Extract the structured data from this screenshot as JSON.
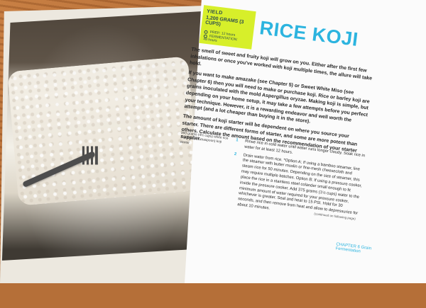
{
  "recipe": {
    "yield_label": "YIELD",
    "yield_value": "1,200 GRAMS (3 CUPS)",
    "prep_label": "PREP: 12 hours",
    "fermentation_label": "FERMENTATION:",
    "fermentation_value": "48 hours",
    "title": "RICE KOJI"
  },
  "content": {
    "intro_1": "The smell of sweet and fruity koji will grow on you. Either after the first few inhalations or once you've worked with koji multiple times, the allure will take hold.",
    "intro_2": "If you want to make amazake (see Chapter 5) or Sweet White Miso (see Chapter 6) then you will need to make or purchase koji. Rice or barley koji are grains inoculated with the mold Aspergillus oryzae. Making koji is simple, but depending on your home setup, it may take a few attempts before you perfect your technique. However, it is a rewarding endeavor and well worth the attempt (and a lot cheaper than buying it in the store).",
    "intro_3": "The amount of koji starter will be dependent on where you source your starter. There are different forms of starter, and some are more potent than others. Calculate the amount based on the recommendation of your starter supplier.",
    "ingredients": [
      "900 grams (4½ cups) white rice",
      "2 grams (1/2 teaspoon) koji starter"
    ],
    "steps": [
      {
        "num": "1",
        "text": "Rinse rice in cold water until water runs longer cloudy. Soak rice in water for at least 12 hours."
      },
      {
        "num": "2",
        "text": "Drain water from rice. *Option A: If using a bamboo steamer, line the steamer with butter muslin or fine-mesh cheesecloth and steam rice for 50 minutes. Depending on the size of steamer, this may require multiple batches. Option B: If using a pressure cooker, place the rice in a stainless steel colander small enough to fit inside the pressure cooker. Add 375 grams (1½ cups) water to the minimum amount of water required for your pressure cooker, whichever is greater. Seal and heat to 15 PSI. Hold for 30 seconds, and then remove from heat and allow to depressurize for about 10 minutes."
      }
    ],
    "continued_label": "(continued on following page)",
    "footer_right": "CHAPTER 6  Grain Fermentation"
  }
}
